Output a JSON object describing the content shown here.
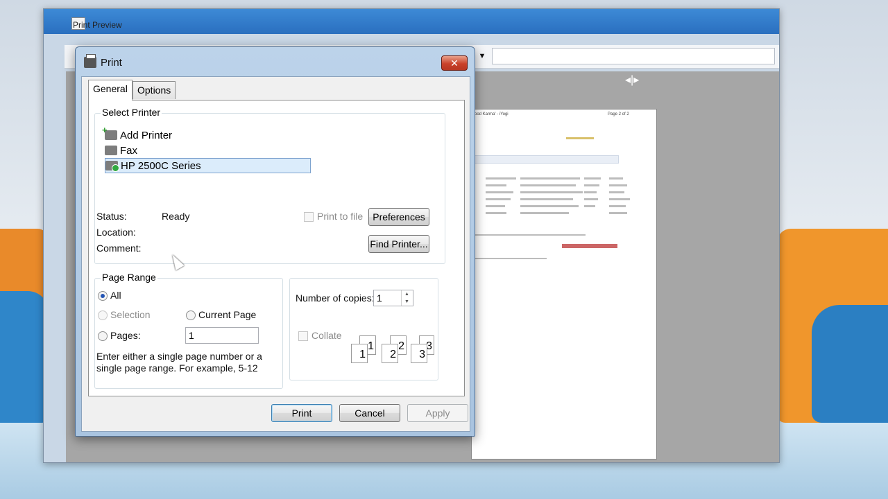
{
  "preview": {
    "title": "Print Preview",
    "page_header_left": "ood Karma' - iYogi",
    "page_header_right": "Page 2 of 2"
  },
  "dialog": {
    "title": "Print",
    "close_label": "✕",
    "tabs": [
      {
        "label": "General",
        "active": true
      },
      {
        "label": "Options",
        "active": false
      }
    ],
    "select_printer": {
      "label": "Select Printer",
      "printers": [
        {
          "name": "Add Printer",
          "icon": "add-printer-icon",
          "selected": false
        },
        {
          "name": "Fax",
          "icon": "fax-icon",
          "selected": false
        },
        {
          "name": "HP 2500C Series",
          "icon": "printer-icon",
          "selected": true
        }
      ],
      "status_label": "Status:",
      "status_value": "Ready",
      "location_label": "Location:",
      "comment_label": "Comment:",
      "print_to_file_label": "Print to file",
      "print_to_file_checked": false,
      "preferences_label": "Preferences",
      "find_printer_label": "Find Printer..."
    },
    "page_range": {
      "label": "Page Range",
      "all_label": "All",
      "selection_label": "Selection",
      "current_page_label": "Current Page",
      "pages_label": "Pages:",
      "pages_value": "1",
      "selected": "All",
      "hint": "Enter either a single page number or a single page range.  For example, 5-12"
    },
    "copies": {
      "number_label": "Number of copies:",
      "number_value": "1",
      "collate_label": "Collate",
      "collate_checked": false,
      "collate_icons": [
        "1",
        "1",
        "2",
        "2",
        "3",
        "3"
      ]
    },
    "buttons": {
      "print": "Print",
      "cancel": "Cancel",
      "apply": "Apply"
    }
  }
}
